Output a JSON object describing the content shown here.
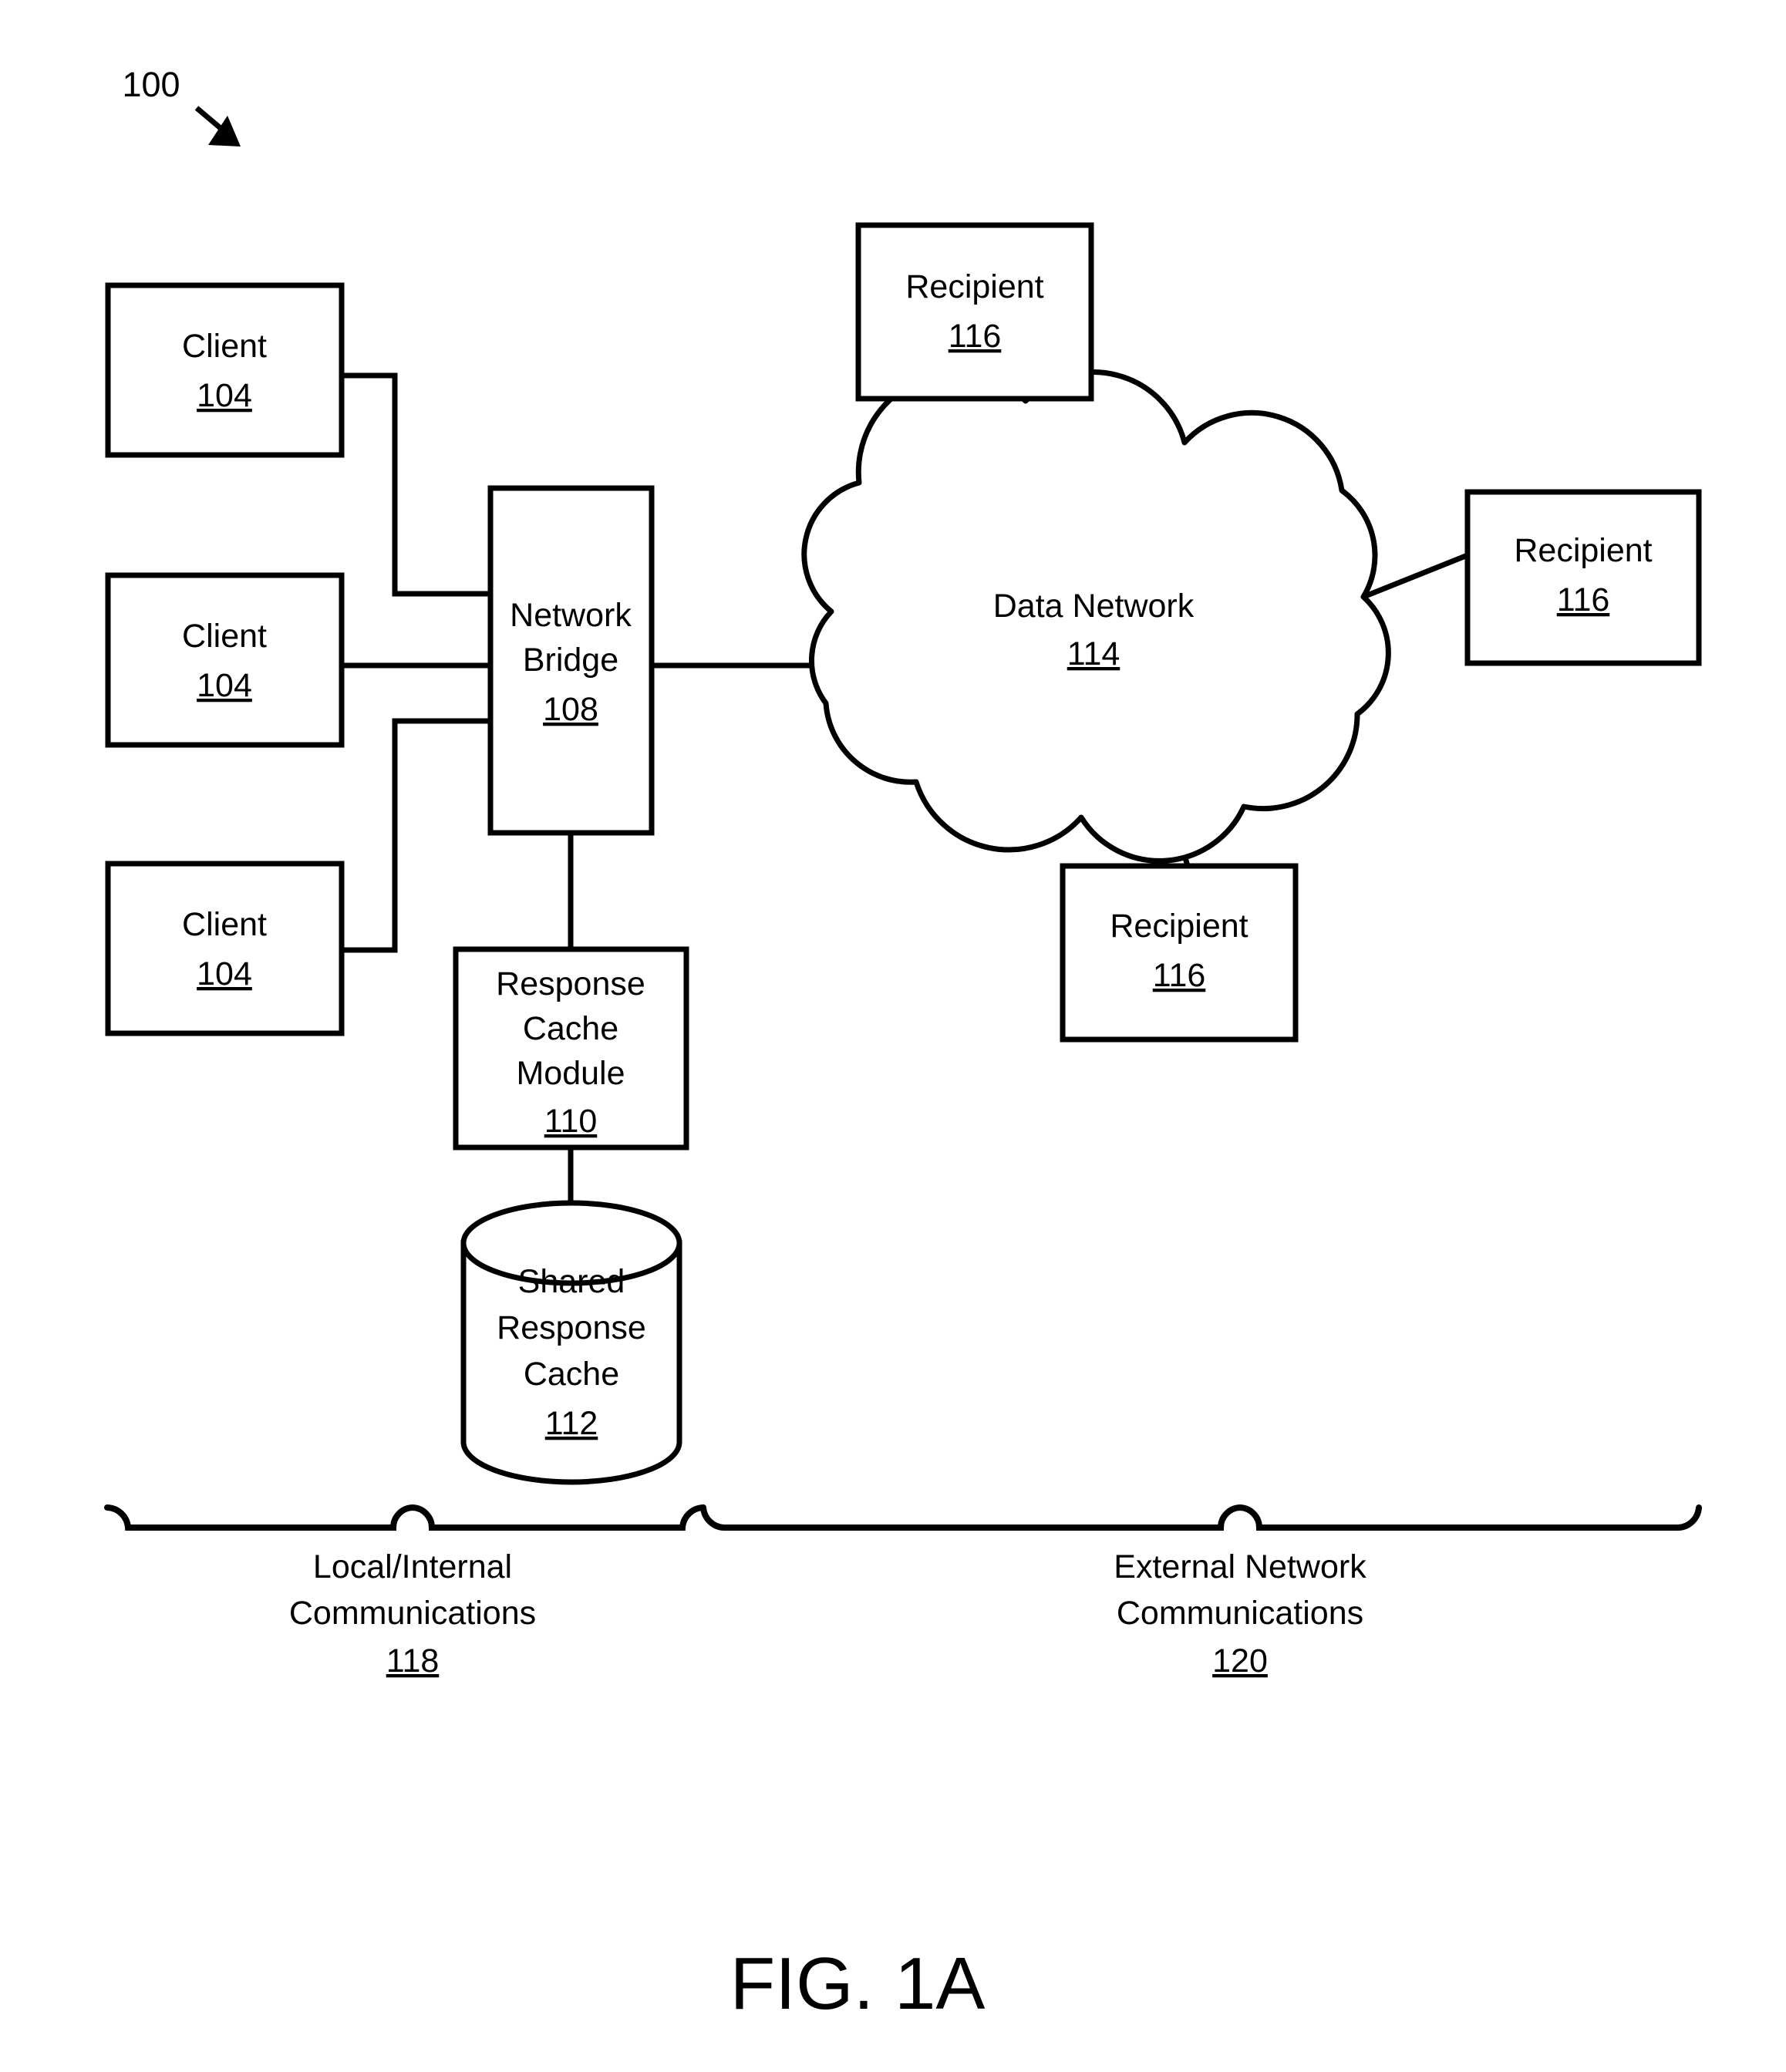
{
  "figure": {
    "ref_numeral": "100",
    "caption": "FIG. 1A"
  },
  "nodes": {
    "client1": {
      "title": "Client",
      "number": "104"
    },
    "client2": {
      "title": "Client",
      "number": "104"
    },
    "client3": {
      "title": "Client",
      "number": "104"
    },
    "network_bridge": {
      "line1": "Network",
      "line2": "Bridge",
      "number": "108"
    },
    "response_cache_module": {
      "line1": "Response",
      "line2": "Cache",
      "line3": "Module",
      "number": "110"
    },
    "shared_response_cache": {
      "line1": "Shared",
      "line2": "Response",
      "line3": "Cache",
      "number": "112"
    },
    "data_network": {
      "title": "Data Network",
      "number": "114"
    },
    "recipient_top": {
      "title": "Recipient",
      "number": "116"
    },
    "recipient_right": {
      "title": "Recipient",
      "number": "116"
    },
    "recipient_bottom": {
      "title": "Recipient",
      "number": "116"
    }
  },
  "regions": {
    "local": {
      "line1": "Local/Internal",
      "line2": "Communications",
      "number": "118"
    },
    "external": {
      "line1": "External Network",
      "line2": "Communications",
      "number": "120"
    }
  },
  "colors": {
    "stroke": "#000000",
    "fill": "#ffffff"
  }
}
